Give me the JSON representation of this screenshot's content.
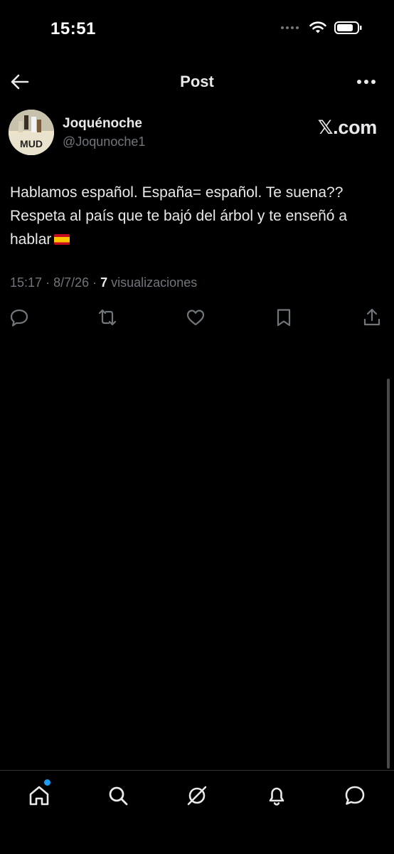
{
  "status_bar": {
    "time": "15:51"
  },
  "header": {
    "title": "Post",
    "back_icon": "arrow-left-icon",
    "more_icon": "more-horizontal-icon"
  },
  "author": {
    "name": "Joquénoche",
    "handle": "@Joqunoche1",
    "avatar_text": "MUD"
  },
  "watermark": "𝕏.com",
  "post": {
    "text": "Hablamos español. España= español. Te suena?? Respeta al país que te bajó del árbol y te enseñó a hablar",
    "flag": "spain-flag-emoji",
    "time": "15:17",
    "date": "8/7/26",
    "views_count": "7",
    "views_label": "visualizaciones"
  },
  "actions": [
    "reply-icon",
    "repost-icon",
    "like-icon",
    "bookmark-icon",
    "share-icon"
  ],
  "bottom_nav": [
    "home-icon",
    "search-icon",
    "grok-icon",
    "notifications-icon",
    "messages-icon"
  ],
  "colors": {
    "background": "#000000",
    "text": "#e7e9ea",
    "secondary": "#71767b",
    "accent": "#1d9bf0"
  }
}
